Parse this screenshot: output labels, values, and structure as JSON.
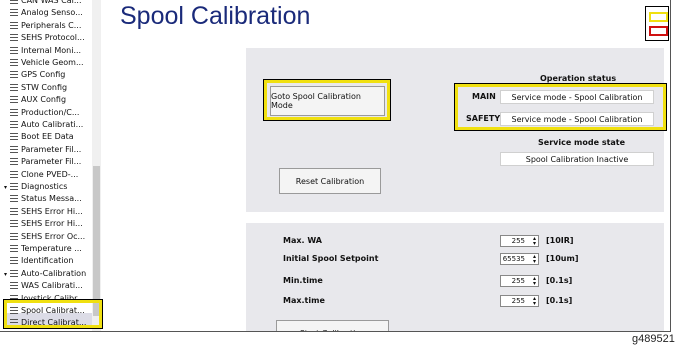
{
  "sidebar": {
    "items": [
      {
        "label": "CAN WAS Cal...",
        "type": "leaf"
      },
      {
        "label": "Analog Senso...",
        "type": "leaf"
      },
      {
        "label": "Peripherals C...",
        "type": "leaf"
      },
      {
        "label": "SEHS Protocol...",
        "type": "leaf"
      },
      {
        "label": "Internal Moni...",
        "type": "leaf"
      },
      {
        "label": "Vehicle Geom...",
        "type": "leaf"
      },
      {
        "label": "GPS Config",
        "type": "leaf"
      },
      {
        "label": "STW Config",
        "type": "leaf"
      },
      {
        "label": "AUX Config",
        "type": "leaf"
      },
      {
        "label": "Production/C...",
        "type": "leaf"
      },
      {
        "label": "Auto Calibrati...",
        "type": "leaf"
      },
      {
        "label": "Boot EE Data",
        "type": "leaf"
      },
      {
        "label": "Parameter Fil...",
        "type": "leaf"
      },
      {
        "label": "Parameter Fil...",
        "type": "leaf"
      },
      {
        "label": "Clone PVED-...",
        "type": "leaf"
      },
      {
        "label": "Diagnostics",
        "type": "group"
      },
      {
        "label": "Status Messa...",
        "type": "leaf"
      },
      {
        "label": "SEHS Error Hi...",
        "type": "leaf"
      },
      {
        "label": "SEHS Error Hi...",
        "type": "leaf"
      },
      {
        "label": "SEHS Error Oc...",
        "type": "leaf"
      },
      {
        "label": "Temperature ...",
        "type": "leaf"
      },
      {
        "label": "Identification",
        "type": "leaf"
      },
      {
        "label": "Auto-Calibration",
        "type": "group"
      },
      {
        "label": "WAS Calibrati...",
        "type": "leaf"
      },
      {
        "label": "Joystick Calibr...",
        "type": "leaf"
      },
      {
        "label": "Spool Calibrat...",
        "type": "leaf"
      },
      {
        "label": "Direct Calibrat...",
        "type": "leaf"
      }
    ]
  },
  "page": {
    "title": "Spool Calibration"
  },
  "top_panel": {
    "goto_button": "Goto Spool Calibration Mode",
    "reset_button": "Reset Calibration",
    "operation_status_header": "Operation status",
    "main_label": "MAIN",
    "main_value": "Service mode - Spool Calibration",
    "safety_label": "SAFETY",
    "safety_value": "Service mode - Spool Calibration",
    "service_mode_header": "Service mode state",
    "service_mode_value": "Spool Calibration Inactive"
  },
  "bottom_panel": {
    "params": [
      {
        "label": "Max. WA",
        "value": "255",
        "unit": "[10IR]"
      },
      {
        "label": "Initial Spool Setpoint",
        "value": "65535",
        "unit": "[10um]"
      },
      {
        "label": "Min.time",
        "value": "255",
        "unit": "[0.1s]"
      },
      {
        "label": "Max.time",
        "value": "255",
        "unit": "[0.1s]"
      }
    ],
    "start_button": "Start Calibration"
  },
  "figure_code": "g489521",
  "colors": {
    "highlight": "#f0e010",
    "title": "#1a2a7a",
    "panel": "#e8e8ec",
    "legend_red": "#d01010"
  }
}
